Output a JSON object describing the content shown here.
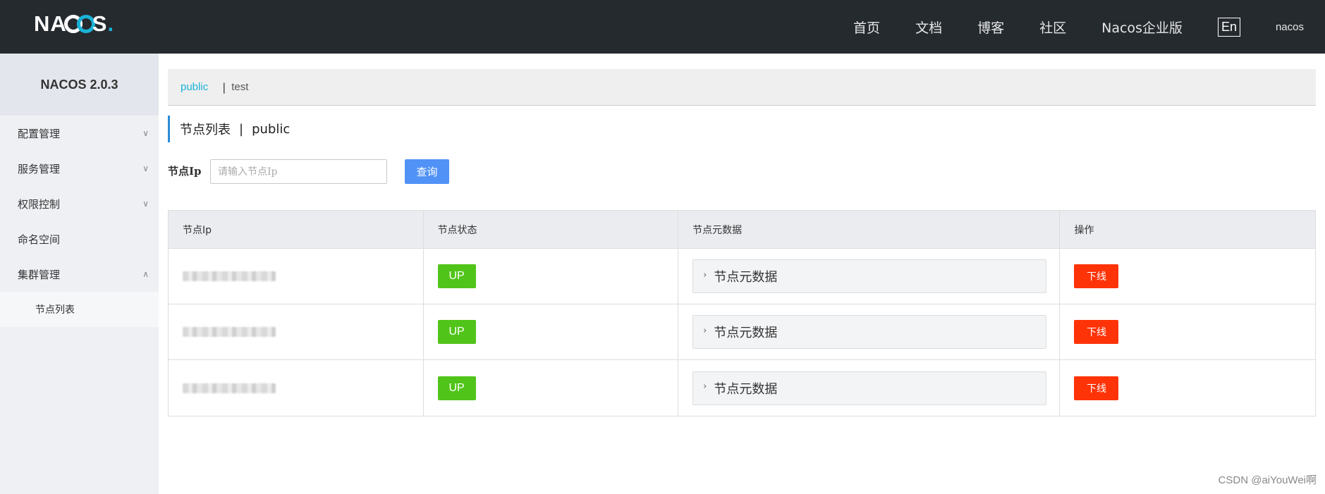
{
  "header": {
    "logo": {
      "n": "N",
      "a": "A",
      "s": "S",
      "dot": "."
    },
    "nav": [
      "首页",
      "文档",
      "博客",
      "社区",
      "Nacos企业版"
    ],
    "lang": "En",
    "user": "nacos"
  },
  "sidebar": {
    "title": "NACOS 2.0.3",
    "items": [
      {
        "label": "配置管理",
        "chevron": "chevron-down-icon"
      },
      {
        "label": "服务管理",
        "chevron": "chevron-down-icon"
      },
      {
        "label": "权限控制",
        "chevron": "chevron-down-icon"
      },
      {
        "label": "命名空间"
      },
      {
        "label": "集群管理",
        "chevron": "chevron-up-icon"
      }
    ],
    "sub_items": [
      {
        "label": "节点列表"
      }
    ]
  },
  "namespaces": {
    "active": "public",
    "separator": "|",
    "other": "test"
  },
  "page_title": {
    "label": "节点列表",
    "separator": "|",
    "namespace": "public"
  },
  "search": {
    "label": "节点Ip",
    "placeholder": "请输入节点Ip",
    "button": "查询"
  },
  "table": {
    "headers": [
      "节点Ip",
      "节点状态",
      "节点元数据",
      "操作"
    ],
    "rows": [
      {
        "status": "UP",
        "meta": "节点元数据",
        "action": "下线"
      },
      {
        "status": "UP",
        "meta": "节点元数据",
        "action": "下线"
      },
      {
        "status": "UP",
        "meta": "节点元数据",
        "action": "下线"
      }
    ]
  },
  "watermark": "CSDN @aiYouWei啊",
  "colors": {
    "topbar": "#252a2f",
    "accent": "#1ab3d8",
    "status_up": "#51c41a",
    "offline": "#ff3308",
    "query": "#5192f7"
  }
}
